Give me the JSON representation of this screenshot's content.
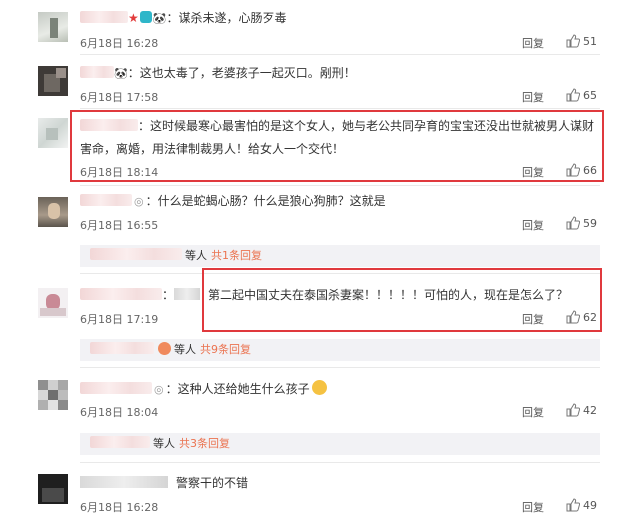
{
  "comments": [
    {
      "text": "：谋杀未遂，心肠歹毒",
      "time": "6月18日 16:28",
      "reply": "回复",
      "likes": "51"
    },
    {
      "text": "：这也太毒了，老婆孩子一起灭口。剐刑！",
      "time": "6月18日 17:58",
      "reply": "回复",
      "likes": "65"
    },
    {
      "text": "：这时候最寒心最害怕的是这个女人，她与老公共同孕育的宝宝还没出世就被男人谋财",
      "text2": "害命，离婚，用法律制裁男人！给女人一个交代！",
      "time": "6月18日 18:14",
      "reply": "回复",
      "likes": "66"
    },
    {
      "text": "：什么是蛇蝎心肠？什么是狼心狗肺？这就是",
      "time": "6月18日 16:55",
      "reply": "回复",
      "likes": "59"
    },
    {
      "text": "第二起中国丈夫在泰国杀妻案！！！！！可怕的人，现在是怎么了？",
      "time": "6月18日 17:19",
      "reply": "回复",
      "likes": "62"
    },
    {
      "text": "：这种人还给她生什么孩子",
      "time": "6月18日 18:04",
      "reply": "回复",
      "likes": "42"
    },
    {
      "text": "警察干的不错",
      "time": "6月18日 16:28",
      "reply": "回复",
      "likes": "49"
    }
  ],
  "subreplies": [
    {
      "who": "等人",
      "link": "共1条回复"
    },
    {
      "who": "等人",
      "link": "共9条回复"
    },
    {
      "who": "等人",
      "link": "共3条回复"
    }
  ],
  "colors": {
    "accent": "#eb7350",
    "highlight_box": "#e0393d"
  },
  "icons": [
    "thumbs-up-icon",
    "crown-badge-icon",
    "panda-emoji-icon",
    "medal-icon",
    "thinking-emoji-icon"
  ]
}
